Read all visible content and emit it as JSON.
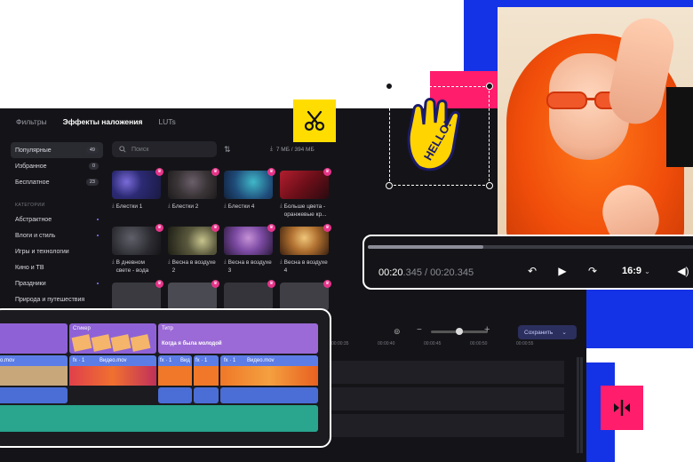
{
  "tabs": {
    "filters": "Фильтры",
    "overlays": "Эффекты наложения",
    "luts": "LUTs"
  },
  "sidebar": {
    "items": [
      {
        "label": "Популярные",
        "count": "49"
      },
      {
        "label": "Избранное",
        "count": "0"
      },
      {
        "label": "Бесплатное",
        "count": "23"
      }
    ],
    "categories_heading": "КАТЕГОРИИ",
    "categories": [
      "Абстрактное",
      "Влоги и стиль",
      "Игры и технологии",
      "Кино и ТВ",
      "Праздники",
      "Природа и путешествия"
    ]
  },
  "search": {
    "placeholder": "Поиск"
  },
  "storage": {
    "text": "7 МБ / 394 МБ"
  },
  "effects": [
    {
      "name": "Блестки 1"
    },
    {
      "name": "Блестки 2"
    },
    {
      "name": "Блестки 4"
    },
    {
      "name": "Больше цвета - оранжевые кр..."
    },
    {
      "name": "В дневном свете - вода"
    },
    {
      "name": "Весна в воздухе 2"
    },
    {
      "name": "Весна в воздухе 3"
    },
    {
      "name": "Весна в воздухе 4"
    }
  ],
  "sticker": {
    "text": "HELLO!"
  },
  "player": {
    "current": "00:20",
    "current_frac": ".345",
    "separator": " / ",
    "total": "00:20.345",
    "ratio": "16:9",
    "progress": 0.35
  },
  "timeline": {
    "sticker_track": "Стикер",
    "title_track": "Титр",
    "title_text": "Когда я была молодой",
    "clip_a": "o.mov",
    "clip_b": "Видео.mov",
    "clip_c": "Видео.mov",
    "clip_d": "Вид",
    "fx": "fx · 1",
    "save_label": "Сохранить",
    "ruler": [
      "00:00:35",
      "00:00:40",
      "00:00:45",
      "00:00:50",
      "00:00:55"
    ]
  },
  "colors": {
    "accent_blue": "#1533e6",
    "accent_magenta": "#ff1d6c",
    "accent_yellow": "#ffdd00",
    "title_purple": "#9b6ad6",
    "audio_teal": "#2aa58e"
  }
}
